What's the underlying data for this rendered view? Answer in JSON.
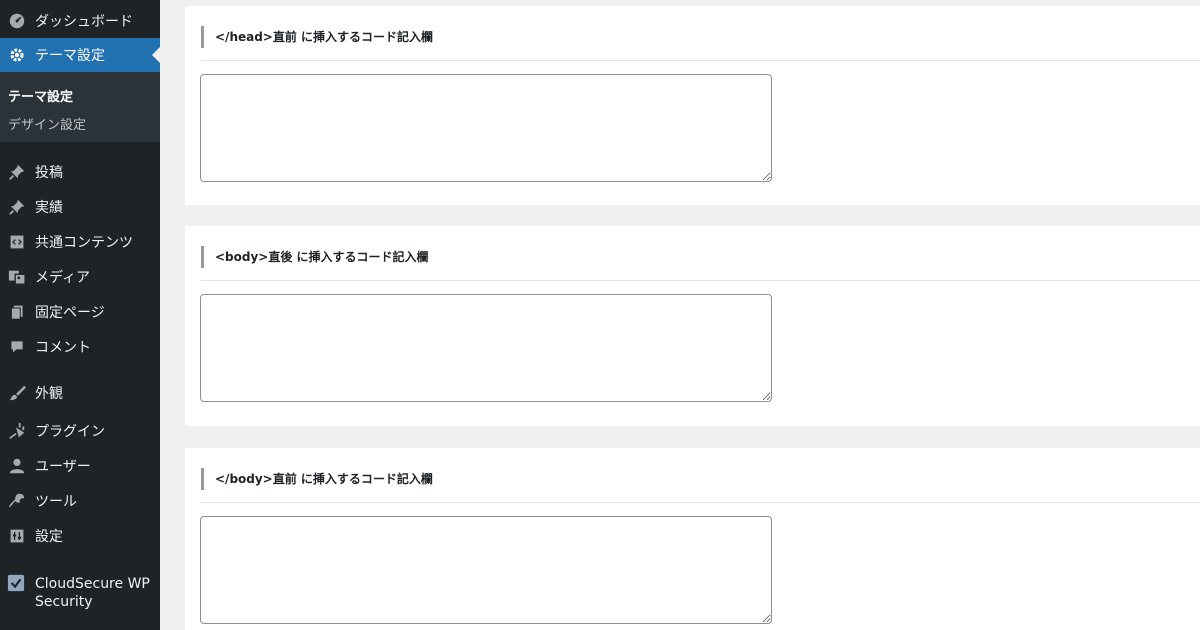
{
  "sidebar": {
    "items": [
      {
        "label": "ダッシュボード",
        "icon": "dashboard-icon"
      },
      {
        "label": "テーマ設定",
        "icon": "gear-icon",
        "current": true
      },
      {
        "label": "投稿",
        "icon": "pin-icon"
      },
      {
        "label": "実績",
        "icon": "pin-icon"
      },
      {
        "label": "共通コンテンツ",
        "icon": "code-block-icon"
      },
      {
        "label": "メディア",
        "icon": "media-icon"
      },
      {
        "label": "固定ページ",
        "icon": "page-icon"
      },
      {
        "label": "コメント",
        "icon": "comment-icon"
      },
      {
        "label": "外観",
        "icon": "brush-icon"
      },
      {
        "label": "プラグイン",
        "icon": "plugin-icon"
      },
      {
        "label": "ユーザー",
        "icon": "user-icon"
      },
      {
        "label": "ツール",
        "icon": "wrench-icon"
      },
      {
        "label": "設定",
        "icon": "settings-icon"
      }
    ],
    "submenu": [
      {
        "label": "テーマ設定",
        "current": true
      },
      {
        "label": "デザイン設定"
      }
    ],
    "security_item": {
      "label": "CloudSecure WP Security",
      "icon": "shield-check-icon"
    }
  },
  "sections": [
    {
      "title": "</head>直前 に挿入するコード記入欄",
      "value": ""
    },
    {
      "title": "<body>直後 に挿入するコード記入欄",
      "value": ""
    },
    {
      "title": "</body>直前 に挿入するコード記入欄",
      "value": ""
    }
  ],
  "colors": {
    "sidebar_bg": "#1d2327",
    "submenu_bg": "#2c3338",
    "accent": "#2271b1",
    "page_bg": "#f0f0f1"
  }
}
